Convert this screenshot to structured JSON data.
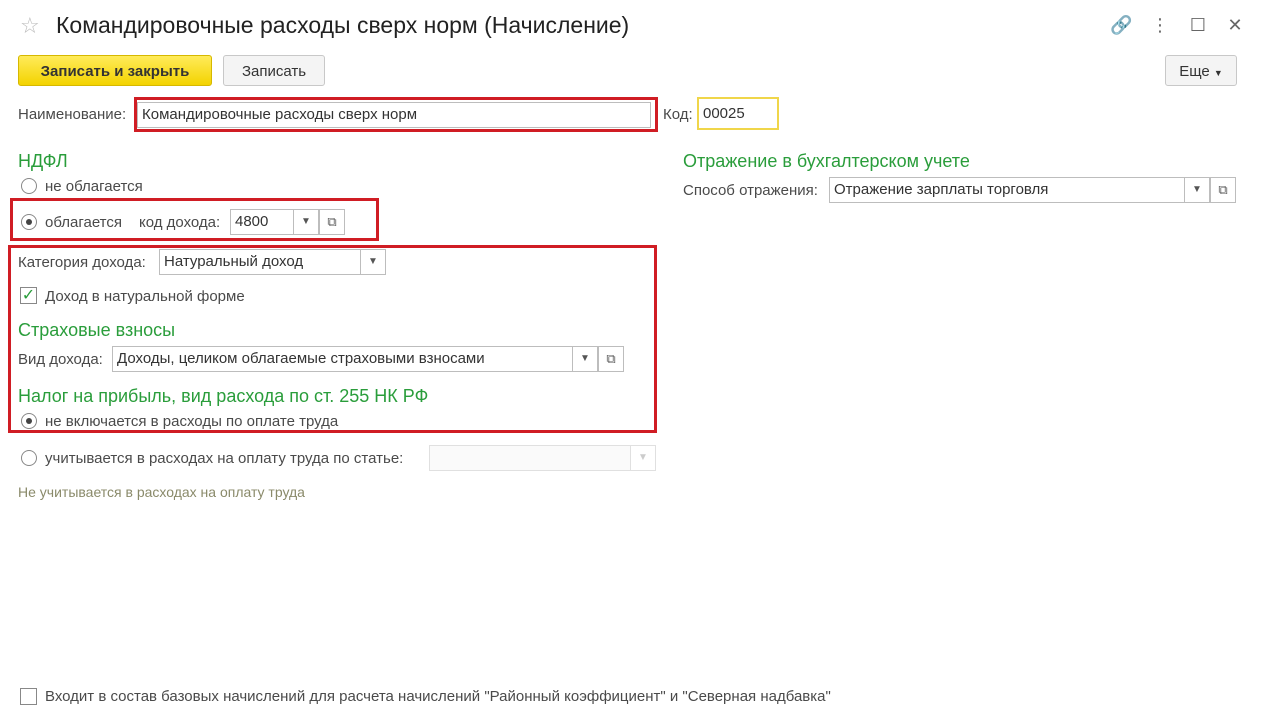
{
  "window": {
    "title": "Командировочные расходы сверх норм (Начисление)",
    "buttons": {
      "link": "🔗",
      "menu": "⋮",
      "maximize": "☐",
      "close": "✕"
    }
  },
  "toolbar": {
    "save_close_label": "Записать и закрыть",
    "save_label": "Записать",
    "more_label": "Еще"
  },
  "name": {
    "label": "Наименование:",
    "value": "Командировочные расходы сверх норм"
  },
  "code": {
    "label": "Код:",
    "value": "00025"
  },
  "ndfl": {
    "title": "НДФЛ",
    "option_not_taxed": "не облагается",
    "option_taxed": "облагается",
    "income_code_label": "код дохода:",
    "income_code_value": "4800"
  },
  "accounting": {
    "title": "Отражение в бухгалтерском учете",
    "method_label": "Способ отражения:",
    "method_value": "Отражение зарплаты торговля"
  },
  "income_category": {
    "label": "Категория дохода:",
    "value": "Натуральный доход"
  },
  "in_kind": {
    "label": "Доход в натуральной форме",
    "checked": true
  },
  "insurance": {
    "title": "Страховые взносы",
    "income_type_label": "Вид дохода:",
    "income_type_value": "Доходы, целиком облагаемые страховыми взносами"
  },
  "profit_tax": {
    "title": "Налог на прибыль, вид расхода по ст. 255 НК РФ",
    "option_excluded": "не включается в расходы по оплате труда",
    "option_included": "учитывается в расходах на оплату труда по статье:",
    "hint": "Не учитывается в расходах на оплату труда"
  },
  "regional": {
    "label": "Входит в состав базовых начислений для расчета начислений \"Районный коэффициент\" и \"Северная надбавка\"",
    "checked": false
  },
  "colors": {
    "highlight": "#d01d24",
    "section_title": "#2a9d3b",
    "primary_button": "#f3d300"
  }
}
